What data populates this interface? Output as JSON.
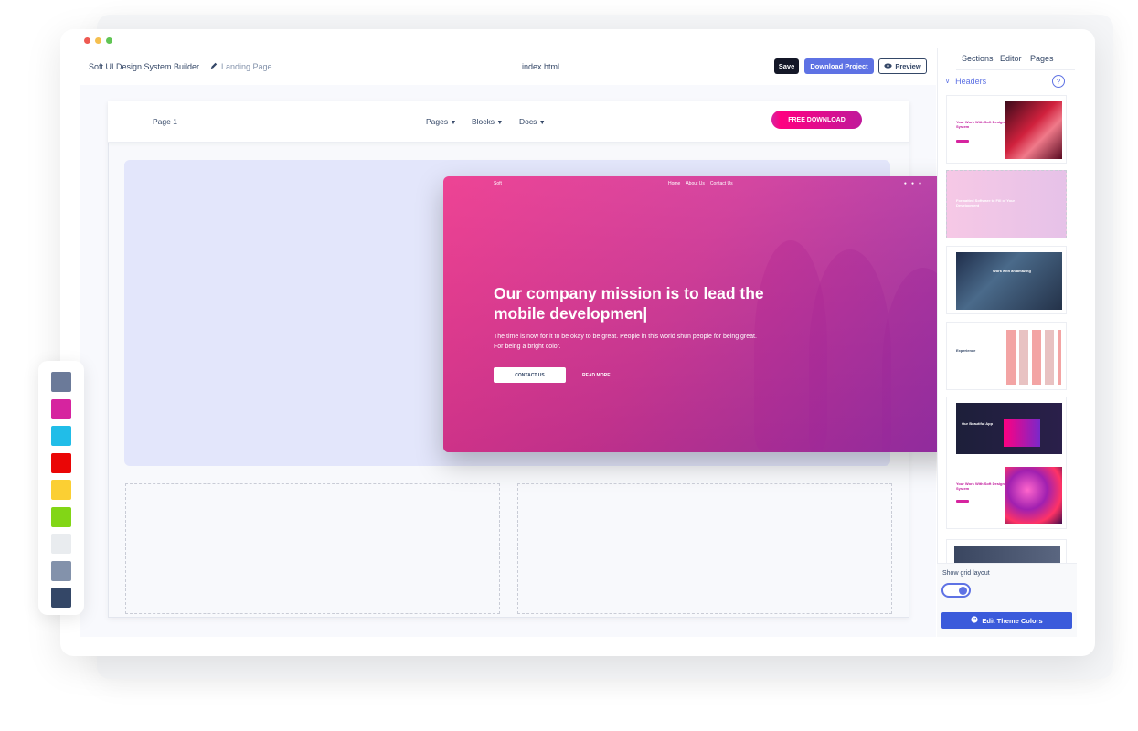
{
  "app": {
    "title": "Soft UI Design System Builder",
    "breadcrumb": "Landing Page",
    "filename": "index.html"
  },
  "toolbar": {
    "save_label": "Save",
    "download_label": "Download Project",
    "preview_label": "Preview"
  },
  "canvas_nav": {
    "brand": "Page 1",
    "links": [
      "Pages",
      "Blocks",
      "Docs"
    ],
    "cta": "FREE DOWNLOAD"
  },
  "hero": {
    "brand": "Soft",
    "nav": [
      "Home",
      "About Us",
      "Contact Us"
    ],
    "social": [
      "twitter-icon",
      "facebook-icon",
      "instagram-icon"
    ],
    "title": "Our company mission is to lead the mobile developmen|",
    "text": "The time is now for it to be okay to be great. People in this world shun people for being great. For being a bright color.",
    "primary_button": "CONTACT US",
    "secondary_button": "READ MORE"
  },
  "swatches": [
    "#6b7a99",
    "#d6249f",
    "#21bde8",
    "#ea0606",
    "#fbcf33",
    "#82d616",
    "#e9ecef",
    "#8392ab",
    "#344767"
  ],
  "sidebar": {
    "tabs": [
      "Sections",
      "Editor",
      "Pages"
    ],
    "section_title": "Headers",
    "help_label": "?",
    "thumbnails": [
      {
        "title": "Your Work With Soft Design System"
      },
      {
        "title": "Formatted Software to Fill of Your Development"
      },
      {
        "title": "Work with an amazing"
      },
      {
        "title": "Experience"
      },
      {
        "title": "Our Beautiful App"
      },
      {
        "title": "Your Work With Soft Design System"
      }
    ],
    "grid_label": "Show grid layout",
    "grid_on": true,
    "edit_button": "Edit Theme Colors"
  },
  "colors": {
    "accent": "#5e72e4",
    "pink": "#d6249f",
    "dark": "#141727"
  }
}
